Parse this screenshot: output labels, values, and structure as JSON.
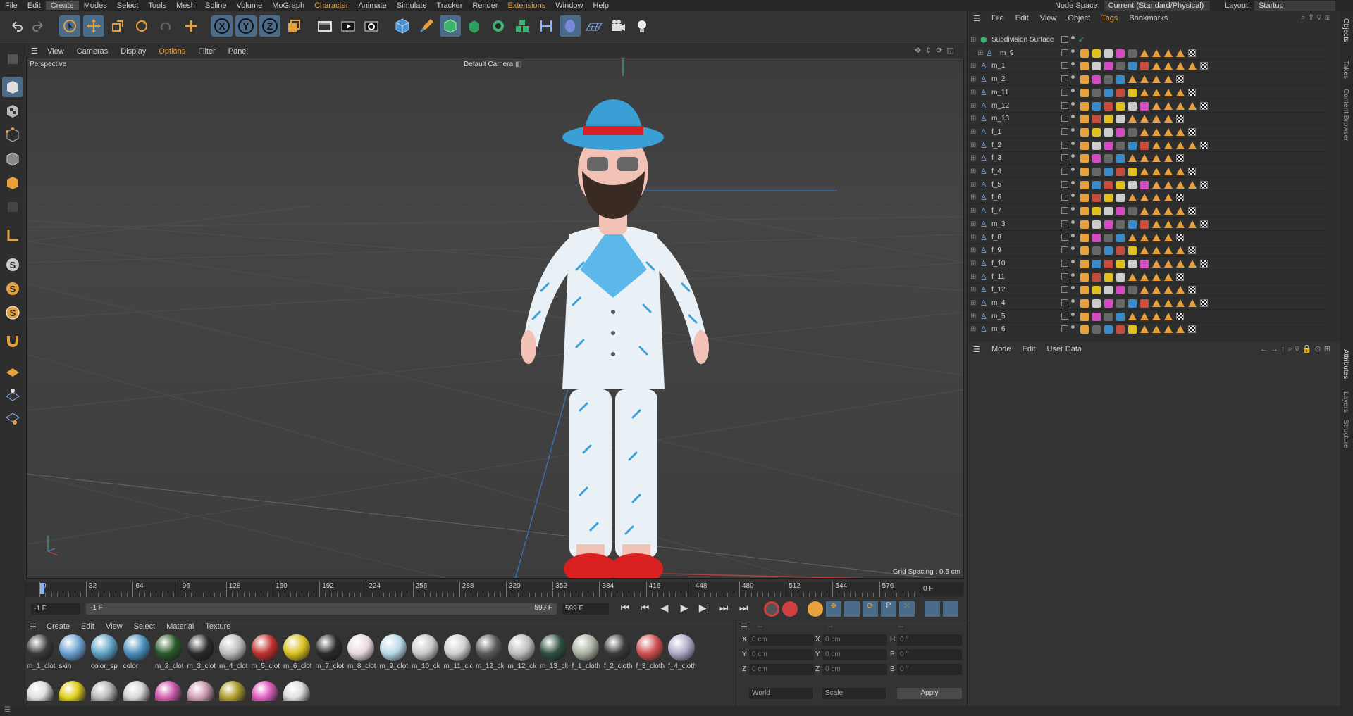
{
  "menu": [
    "File",
    "Edit",
    "Create",
    "Modes",
    "Select",
    "Tools",
    "Mesh",
    "Spline",
    "Volume",
    "MoGraph",
    "Character",
    "Animate",
    "Simulate",
    "Tracker",
    "Render",
    "Extensions",
    "Window",
    "Help"
  ],
  "node_space": {
    "label": "Node Space:",
    "value": "Current (Standard/Physical)"
  },
  "layout": {
    "label": "Layout:",
    "value": "Startup"
  },
  "viewport_menu": [
    "View",
    "Cameras",
    "Display",
    "Options",
    "Filter",
    "Panel"
  ],
  "viewport": {
    "name": "Perspective",
    "camera": "Default Camera",
    "grid_spacing": "Grid Spacing : 0.5 cm"
  },
  "timeline": {
    "ticks": [
      "0",
      "32",
      "64",
      "96",
      "128",
      "160",
      "192",
      "224",
      "256",
      "288",
      "320",
      "352",
      "384",
      "416",
      "448",
      "480",
      "512",
      "544",
      "576"
    ],
    "current": "0 F"
  },
  "transport": {
    "start": "-1 F",
    "range_start": "-1 F",
    "range_end": "599 F",
    "end": "599 F"
  },
  "material_menu": [
    "Create",
    "Edit",
    "View",
    "Select",
    "Material",
    "Texture"
  ],
  "materials": [
    {
      "label": "m_1_clot",
      "color": "#3a3a3a"
    },
    {
      "label": "skin",
      "color": "#6a9fd0"
    },
    {
      "label": "color_sp",
      "color": "#5fa3c4"
    },
    {
      "label": "color",
      "color": "#4a8dbb"
    },
    {
      "label": "m_2_clot",
      "color": "#2a5a2a"
    },
    {
      "label": "m_3_clot",
      "color": "#2a2a2a"
    },
    {
      "label": "m_4_clot",
      "color": "#bbbbbb"
    },
    {
      "label": "m_5_clot",
      "color": "#c03030"
    },
    {
      "label": "m_6_clot",
      "color": "#d8c020"
    },
    {
      "label": "m_7_clot",
      "color": "#2b2b2b"
    },
    {
      "label": "m_8_clot",
      "color": "#e8d8e0"
    },
    {
      "label": "m_9_clot",
      "color": "#b8d8e8"
    },
    {
      "label": "m_10_clo",
      "color": "#c8c8c8"
    },
    {
      "label": "m_11_clo",
      "color": "#d0d0d0"
    },
    {
      "label": "m_12_clo",
      "color": "#5a5a5a"
    },
    {
      "label": "m_12_clo",
      "color": "#bdbdbd"
    },
    {
      "label": "m_13_clo",
      "color": "#2f4f3f"
    },
    {
      "label": "f_1_cloth",
      "color": "#a8b0a0"
    },
    {
      "label": "f_2_cloth",
      "color": "#3a3a3a"
    },
    {
      "label": "f_3_cloth",
      "color": "#d05050"
    },
    {
      "label": "f_4_cloth",
      "color": "#b0a8c8"
    }
  ],
  "materials_row2": [
    "#e0e0e0",
    "#e0d020",
    "#bbbbbb",
    "#d8d8d8",
    "#d060b0",
    "#d0a0b8",
    "#b0a030",
    "#e060c0",
    "#e0e0e0"
  ],
  "coords": {
    "rows": [
      {
        "a": "X",
        "av": "0 cm",
        "b": "X",
        "bv": "0 cm",
        "c": "H",
        "cv": "0 °"
      },
      {
        "a": "Y",
        "av": "0 cm",
        "b": "Y",
        "bv": "0 cm",
        "c": "P",
        "cv": "0 °"
      },
      {
        "a": "Z",
        "av": "0 cm",
        "b": "Z",
        "bv": "0 cm",
        "c": "B",
        "cv": "0 °"
      }
    ],
    "header_a": "--",
    "header_b": "--",
    "header_c": "--",
    "world": "World",
    "scale": "Scale",
    "apply": "Apply"
  },
  "obj_menu": [
    "File",
    "Edit",
    "View",
    "Object",
    "Tags",
    "Bookmarks"
  ],
  "objects": [
    "Subdivision Surface",
    "m_9",
    "m_1",
    "m_2",
    "m_11",
    "m_12",
    "m_13",
    "f_1",
    "f_2",
    "f_3",
    "f_4",
    "f_5",
    "f_6",
    "f_7",
    "m_3",
    "f_8",
    "f_9",
    "f_10",
    "f_11",
    "f_12",
    "m_4",
    "m_5",
    "m_6"
  ],
  "attr_menu": [
    "Mode",
    "Edit",
    "User Data"
  ],
  "side_tabs": [
    "Objects",
    "Takes",
    "Content Browser",
    "Attributes",
    "Layers",
    "Structure"
  ]
}
